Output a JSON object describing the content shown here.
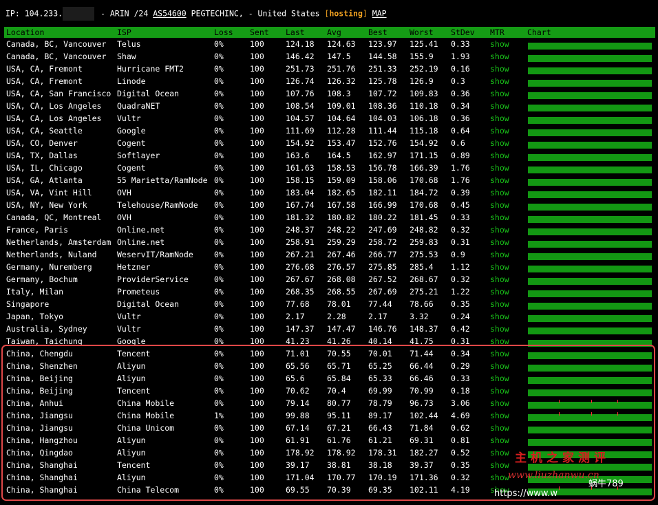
{
  "header": {
    "ip_label": "IP: 104.233.",
    "after_redact": "- ARIN /24",
    "asn": "AS54600",
    "org_country": "PEGTECHINC, - United States",
    "bracket_open": "[",
    "hosting": "hosting",
    "bracket_close": "]",
    "map": "MAP"
  },
  "columns": {
    "location": "Location",
    "isp": "ISP",
    "loss": "Loss",
    "sent": "Sent",
    "last": "Last",
    "avg": "Avg",
    "best": "Best",
    "worst": "Worst",
    "stdev": "StDev",
    "mtr": "MTR",
    "chart": "Chart"
  },
  "rows": [
    {
      "location": "Canada, BC, Vancouver",
      "isp": "Telus",
      "loss": "0%",
      "sent": "100",
      "last": "124.18",
      "avg": "124.63",
      "best": "123.97",
      "worst": "125.41",
      "stdev": "0.33",
      "mtr": "show"
    },
    {
      "location": "Canada, BC, Vancouver",
      "isp": "Shaw",
      "loss": "0%",
      "sent": "100",
      "last": "146.42",
      "avg": "147.5",
      "best": "144.58",
      "worst": "155.9",
      "stdev": "1.93",
      "mtr": "show"
    },
    {
      "location": "USA, CA, Fremont",
      "isp": "Hurricane FMT2",
      "loss": "0%",
      "sent": "100",
      "last": "251.73",
      "avg": "251.76",
      "best": "251.33",
      "worst": "252.19",
      "stdev": "0.16",
      "mtr": "show"
    },
    {
      "location": "USA, CA, Fremont",
      "isp": "Linode",
      "loss": "0%",
      "sent": "100",
      "last": "126.74",
      "avg": "126.32",
      "best": "125.78",
      "worst": "126.9",
      "stdev": "0.3",
      "mtr": "show"
    },
    {
      "location": "USA, CA, San Francisco",
      "isp": "Digital Ocean",
      "loss": "0%",
      "sent": "100",
      "last": "107.76",
      "avg": "108.3",
      "best": "107.72",
      "worst": "109.83",
      "stdev": "0.36",
      "mtr": "show"
    },
    {
      "location": "USA, CA, Los Angeles",
      "isp": "QuadraNET",
      "loss": "0%",
      "sent": "100",
      "last": "108.54",
      "avg": "109.01",
      "best": "108.36",
      "worst": "110.18",
      "stdev": "0.34",
      "mtr": "show"
    },
    {
      "location": "USA, CA, Los Angeles",
      "isp": "Vultr",
      "loss": "0%",
      "sent": "100",
      "last": "104.57",
      "avg": "104.64",
      "best": "104.03",
      "worst": "106.18",
      "stdev": "0.36",
      "mtr": "show"
    },
    {
      "location": "USA, CA, Seattle",
      "isp": "Google",
      "loss": "0%",
      "sent": "100",
      "last": "111.69",
      "avg": "112.28",
      "best": "111.44",
      "worst": "115.18",
      "stdev": "0.64",
      "mtr": "show"
    },
    {
      "location": "USA, CO, Denver",
      "isp": "Cogent",
      "loss": "0%",
      "sent": "100",
      "last": "154.92",
      "avg": "153.47",
      "best": "152.76",
      "worst": "154.92",
      "stdev": "0.6",
      "mtr": "show"
    },
    {
      "location": "USA, TX, Dallas",
      "isp": "Softlayer",
      "loss": "0%",
      "sent": "100",
      "last": "163.6",
      "avg": "164.5",
      "best": "162.97",
      "worst": "171.15",
      "stdev": "0.89",
      "mtr": "show"
    },
    {
      "location": "USA, IL, Chicago",
      "isp": "Cogent",
      "loss": "0%",
      "sent": "100",
      "last": "161.63",
      "avg": "158.53",
      "best": "156.78",
      "worst": "166.39",
      "stdev": "1.76",
      "mtr": "show"
    },
    {
      "location": "USA, GA, Atlanta",
      "isp": "55 Marietta/RamNode",
      "loss": "0%",
      "sent": "100",
      "last": "158.15",
      "avg": "159.09",
      "best": "158.06",
      "worst": "170.68",
      "stdev": "1.76",
      "mtr": "show"
    },
    {
      "location": "USA, VA, Vint Hill",
      "isp": "OVH",
      "loss": "0%",
      "sent": "100",
      "last": "183.04",
      "avg": "182.65",
      "best": "182.11",
      "worst": "184.72",
      "stdev": "0.39",
      "mtr": "show"
    },
    {
      "location": "USA, NY, New York",
      "isp": "Telehouse/RamNode",
      "loss": "0%",
      "sent": "100",
      "last": "167.74",
      "avg": "167.58",
      "best": "166.99",
      "worst": "170.68",
      "stdev": "0.45",
      "mtr": "show"
    },
    {
      "location": "Canada, QC, Montreal",
      "isp": "OVH",
      "loss": "0%",
      "sent": "100",
      "last": "181.32",
      "avg": "180.82",
      "best": "180.22",
      "worst": "181.45",
      "stdev": "0.33",
      "mtr": "show"
    },
    {
      "location": "France, Paris",
      "isp": "Online.net",
      "loss": "0%",
      "sent": "100",
      "last": "248.37",
      "avg": "248.22",
      "best": "247.69",
      "worst": "248.82",
      "stdev": "0.32",
      "mtr": "show"
    },
    {
      "location": "Netherlands, Amsterdam",
      "isp": "Online.net",
      "loss": "0%",
      "sent": "100",
      "last": "258.91",
      "avg": "259.29",
      "best": "258.72",
      "worst": "259.83",
      "stdev": "0.31",
      "mtr": "show"
    },
    {
      "location": "Netherlands, Nuland",
      "isp": "WeservIT/RamNode",
      "loss": "0%",
      "sent": "100",
      "last": "267.21",
      "avg": "267.46",
      "best": "266.77",
      "worst": "275.53",
      "stdev": "0.9",
      "mtr": "show"
    },
    {
      "location": "Germany, Nuremberg",
      "isp": "Hetzner",
      "loss": "0%",
      "sent": "100",
      "last": "276.68",
      "avg": "276.57",
      "best": "275.85",
      "worst": "285.4",
      "stdev": "1.12",
      "mtr": "show"
    },
    {
      "location": "Germany, Bochum",
      "isp": "ProviderService",
      "loss": "0%",
      "sent": "100",
      "last": "267.67",
      "avg": "268.08",
      "best": "267.52",
      "worst": "268.67",
      "stdev": "0.32",
      "mtr": "show"
    },
    {
      "location": "Italy, Milan",
      "isp": "Prometeus",
      "loss": "0%",
      "sent": "100",
      "last": "268.35",
      "avg": "268.55",
      "best": "267.69",
      "worst": "275.21",
      "stdev": "1.22",
      "mtr": "show"
    },
    {
      "location": "Singapore",
      "isp": "Digital Ocean",
      "loss": "0%",
      "sent": "100",
      "last": "77.68",
      "avg": "78.01",
      "best": "77.44",
      "worst": "78.66",
      "stdev": "0.35",
      "mtr": "show"
    },
    {
      "location": "Japan, Tokyo",
      "isp": "Vultr",
      "loss": "0%",
      "sent": "100",
      "last": "2.17",
      "avg": "2.28",
      "best": "2.17",
      "worst": "3.32",
      "stdev": "0.24",
      "mtr": "show"
    },
    {
      "location": "Australia, Sydney",
      "isp": "Vultr",
      "loss": "0%",
      "sent": "100",
      "last": "147.37",
      "avg": "147.47",
      "best": "146.76",
      "worst": "148.37",
      "stdev": "0.42",
      "mtr": "show"
    },
    {
      "location": "Taiwan, Taichung",
      "isp": "Google",
      "loss": "0%",
      "sent": "100",
      "last": "41.23",
      "avg": "41.26",
      "best": "40.14",
      "worst": "41.75",
      "stdev": "0.31",
      "mtr": "show"
    },
    {
      "location": "China, Chengdu",
      "isp": "Tencent",
      "loss": "0%",
      "sent": "100",
      "last": "71.01",
      "avg": "70.55",
      "best": "70.01",
      "worst": "71.44",
      "stdev": "0.34",
      "mtr": "show"
    },
    {
      "location": "China, Shenzhen",
      "isp": "Aliyun",
      "loss": "0%",
      "sent": "100",
      "last": "65.56",
      "avg": "65.71",
      "best": "65.25",
      "worst": "66.44",
      "stdev": "0.29",
      "mtr": "show"
    },
    {
      "location": "China, Beijing",
      "isp": "Aliyun",
      "loss": "0%",
      "sent": "100",
      "last": "65.6",
      "avg": "65.84",
      "best": "65.33",
      "worst": "66.46",
      "stdev": "0.33",
      "mtr": "show"
    },
    {
      "location": "China, Beijing",
      "isp": "Tencent",
      "loss": "0%",
      "sent": "100",
      "last": "70.62",
      "avg": "70.4",
      "best": "69.99",
      "worst": "70.99",
      "stdev": "0.18",
      "mtr": "show"
    },
    {
      "location": "China, Anhui",
      "isp": "China Mobile",
      "loss": "0%",
      "sent": "100",
      "last": "79.14",
      "avg": "80.77",
      "best": "78.79",
      "worst": "96.73",
      "stdev": "3.06",
      "mtr": "show"
    },
    {
      "location": "China, Jiangsu",
      "isp": "China Mobile",
      "loss": "1%",
      "sent": "100",
      "last": "99.88",
      "avg": "95.11",
      "best": "89.17",
      "worst": "102.44",
      "stdev": "4.69",
      "mtr": "show"
    },
    {
      "location": "China, Jiangsu",
      "isp": "China Unicom",
      "loss": "0%",
      "sent": "100",
      "last": "67.14",
      "avg": "67.21",
      "best": "66.43",
      "worst": "71.84",
      "stdev": "0.62",
      "mtr": "show"
    },
    {
      "location": "China, Hangzhou",
      "isp": "Aliyun",
      "loss": "0%",
      "sent": "100",
      "last": "61.91",
      "avg": "61.76",
      "best": "61.21",
      "worst": "69.31",
      "stdev": "0.81",
      "mtr": "show"
    },
    {
      "location": "China, Qingdao",
      "isp": "Aliyun",
      "loss": "0%",
      "sent": "100",
      "last": "178.92",
      "avg": "178.92",
      "best": "178.31",
      "worst": "182.27",
      "stdev": "0.52",
      "mtr": "show"
    },
    {
      "location": "China, Shanghai",
      "isp": "Tencent",
      "loss": "0%",
      "sent": "100",
      "last": "39.17",
      "avg": "38.81",
      "best": "38.18",
      "worst": "39.37",
      "stdev": "0.35",
      "mtr": "show"
    },
    {
      "location": "China, Shanghai",
      "isp": "Aliyun",
      "loss": "0%",
      "sent": "100",
      "last": "171.04",
      "avg": "170.77",
      "best": "170.19",
      "worst": "171.36",
      "stdev": "0.32",
      "mtr": "show"
    },
    {
      "location": "China, Shanghai",
      "isp": "China Telecom",
      "loss": "0%",
      "sent": "100",
      "last": "69.55",
      "avg": "70.39",
      "best": "69.35",
      "worst": "102.11",
      "stdev": "4.19",
      "mtr": "show"
    }
  ],
  "watermark": {
    "cn_title": "主机之家测评",
    "url": "www.liuzhanwu.cn",
    "author": "蜗牛789",
    "https": "https://www.w"
  },
  "colors": {
    "background": "#000000",
    "header_bar": "#159c15",
    "show_link": "#19c319",
    "chart_bar": "#139813",
    "hosting_tag": "#f0a020",
    "highlight_border": "#e04848"
  }
}
